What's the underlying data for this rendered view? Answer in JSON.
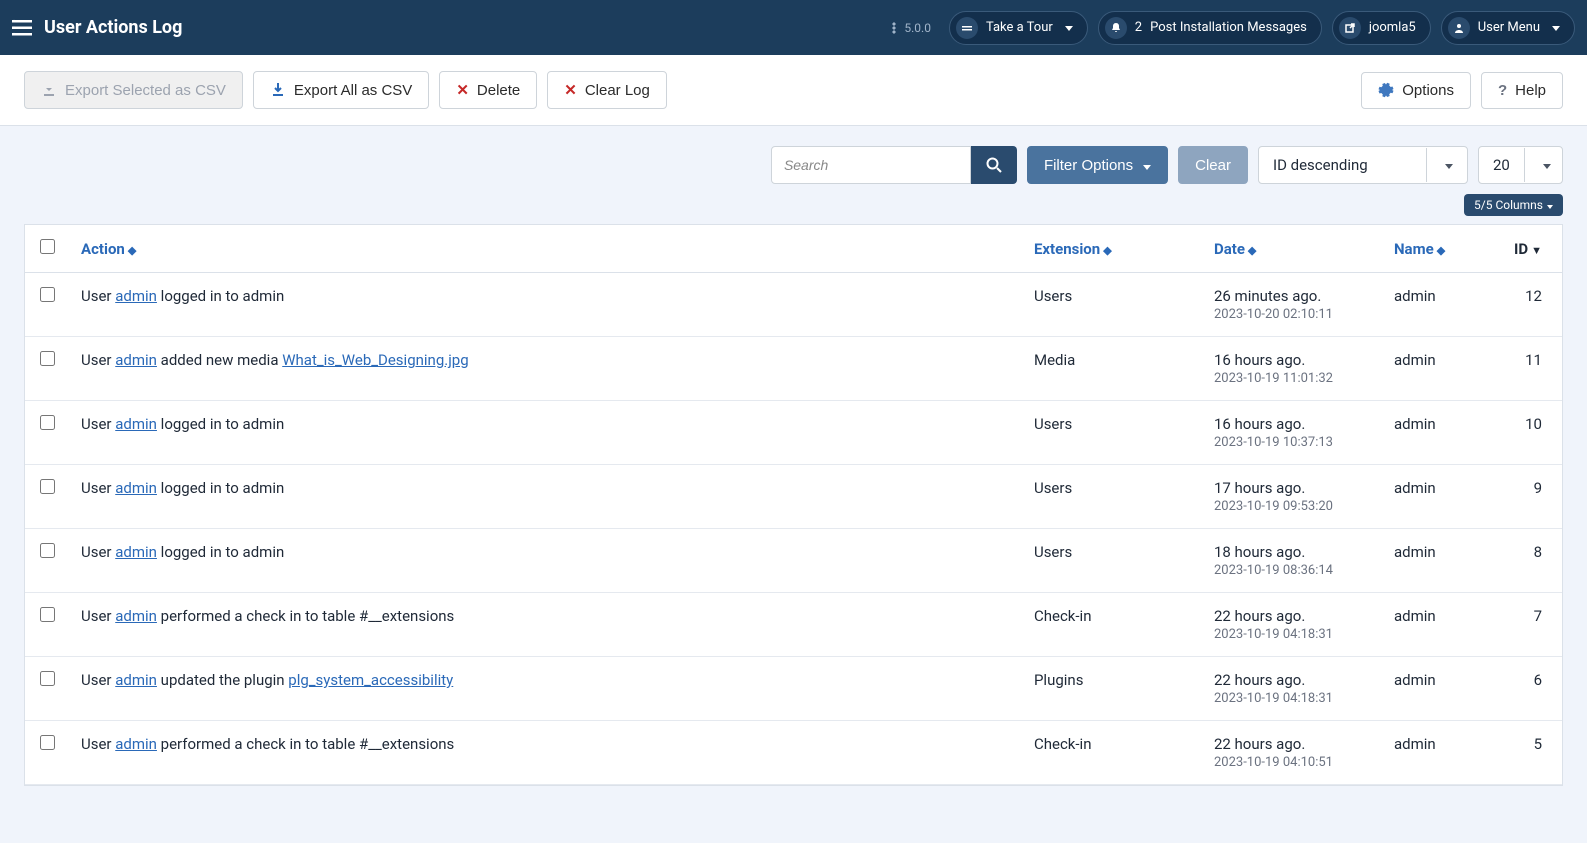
{
  "header": {
    "page_title": "User Actions Log",
    "version": "5.0.0",
    "take_tour": "Take a Tour",
    "notif_count": "2",
    "post_install": "Post Installation Messages",
    "site_name": "joomla5",
    "user_menu": "User Menu"
  },
  "toolbar": {
    "export_selected": "Export Selected as CSV",
    "export_all": "Export All as CSV",
    "delete": "Delete",
    "clear_log": "Clear Log",
    "options": "Options",
    "help": "Help"
  },
  "filters": {
    "search_placeholder": "Search",
    "filter_options": "Filter Options",
    "clear": "Clear",
    "sort": "ID descending",
    "limit": "20",
    "columns": "5/5 Columns"
  },
  "table": {
    "headers": {
      "action": "Action",
      "extension": "Extension",
      "date": "Date",
      "name": "Name",
      "id": "ID"
    },
    "rows": [
      {
        "action_pre": "User ",
        "action_link": "admin",
        "action_post": " logged in to admin",
        "action_link2": "",
        "extension": "Users",
        "date_rel": "26 minutes ago.",
        "date_abs": "2023-10-20 02:10:11",
        "name": "admin",
        "id": "12"
      },
      {
        "action_pre": "User ",
        "action_link": "admin",
        "action_post": " added new media ",
        "action_link2": "What_is_Web_Designing.jpg",
        "extension": "Media",
        "date_rel": "16 hours ago.",
        "date_abs": "2023-10-19 11:01:32",
        "name": "admin",
        "id": "11"
      },
      {
        "action_pre": "User ",
        "action_link": "admin",
        "action_post": " logged in to admin",
        "action_link2": "",
        "extension": "Users",
        "date_rel": "16 hours ago.",
        "date_abs": "2023-10-19 10:37:13",
        "name": "admin",
        "id": "10"
      },
      {
        "action_pre": "User ",
        "action_link": "admin",
        "action_post": " logged in to admin",
        "action_link2": "",
        "extension": "Users",
        "date_rel": "17 hours ago.",
        "date_abs": "2023-10-19 09:53:20",
        "name": "admin",
        "id": "9"
      },
      {
        "action_pre": "User ",
        "action_link": "admin",
        "action_post": " logged in to admin",
        "action_link2": "",
        "extension": "Users",
        "date_rel": "18 hours ago.",
        "date_abs": "2023-10-19 08:36:14",
        "name": "admin",
        "id": "8"
      },
      {
        "action_pre": "User ",
        "action_link": "admin",
        "action_post": " performed a check in to table #__extensions",
        "action_link2": "",
        "extension": "Check-in",
        "date_rel": "22 hours ago.",
        "date_abs": "2023-10-19 04:18:31",
        "name": "admin",
        "id": "7"
      },
      {
        "action_pre": "User ",
        "action_link": "admin",
        "action_post": " updated the plugin ",
        "action_link2": "plg_system_accessibility",
        "extension": "Plugins",
        "date_rel": "22 hours ago.",
        "date_abs": "2023-10-19 04:18:31",
        "name": "admin",
        "id": "6"
      },
      {
        "action_pre": "User ",
        "action_link": "admin",
        "action_post": " performed a check in to table #__extensions",
        "action_link2": "",
        "extension": "Check-in",
        "date_rel": "22 hours ago.",
        "date_abs": "2023-10-19 04:10:51",
        "name": "admin",
        "id": "5"
      }
    ]
  }
}
